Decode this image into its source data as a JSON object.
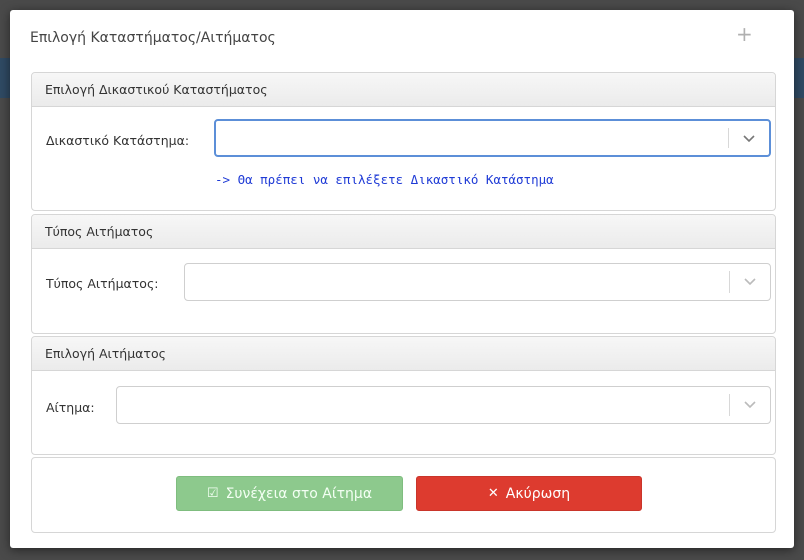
{
  "modal": {
    "title": "Επιλογή Καταστήματος/Αιτήματος",
    "close_glyph": "+"
  },
  "store_panel": {
    "heading": "Επιλογή Δικαστικού Καταστήματος",
    "label": "Δικαστικό Κατάστημα:",
    "value": "",
    "hint": "-> Θα πρέπει να επιλέξετε Δικαστικό Κατάστημα"
  },
  "type_panel": {
    "heading": "Τύπος Αιτήματος",
    "label": "Τύπος Αιτήματος:",
    "value": ""
  },
  "request_panel": {
    "heading": "Επιλογή Αιτήματος",
    "label": "Αίτημα:",
    "value": ""
  },
  "buttons": {
    "continue_label": "Συνέχεια στο Αίτημα",
    "continue_icon": "☑",
    "cancel_label": "Ακύρωση",
    "cancel_icon": "✕"
  },
  "colors": {
    "continue": "#8dc98d",
    "cancel": "#dd3b2f",
    "hint": "#1f3bd6",
    "focus": "#5c8fd8"
  }
}
